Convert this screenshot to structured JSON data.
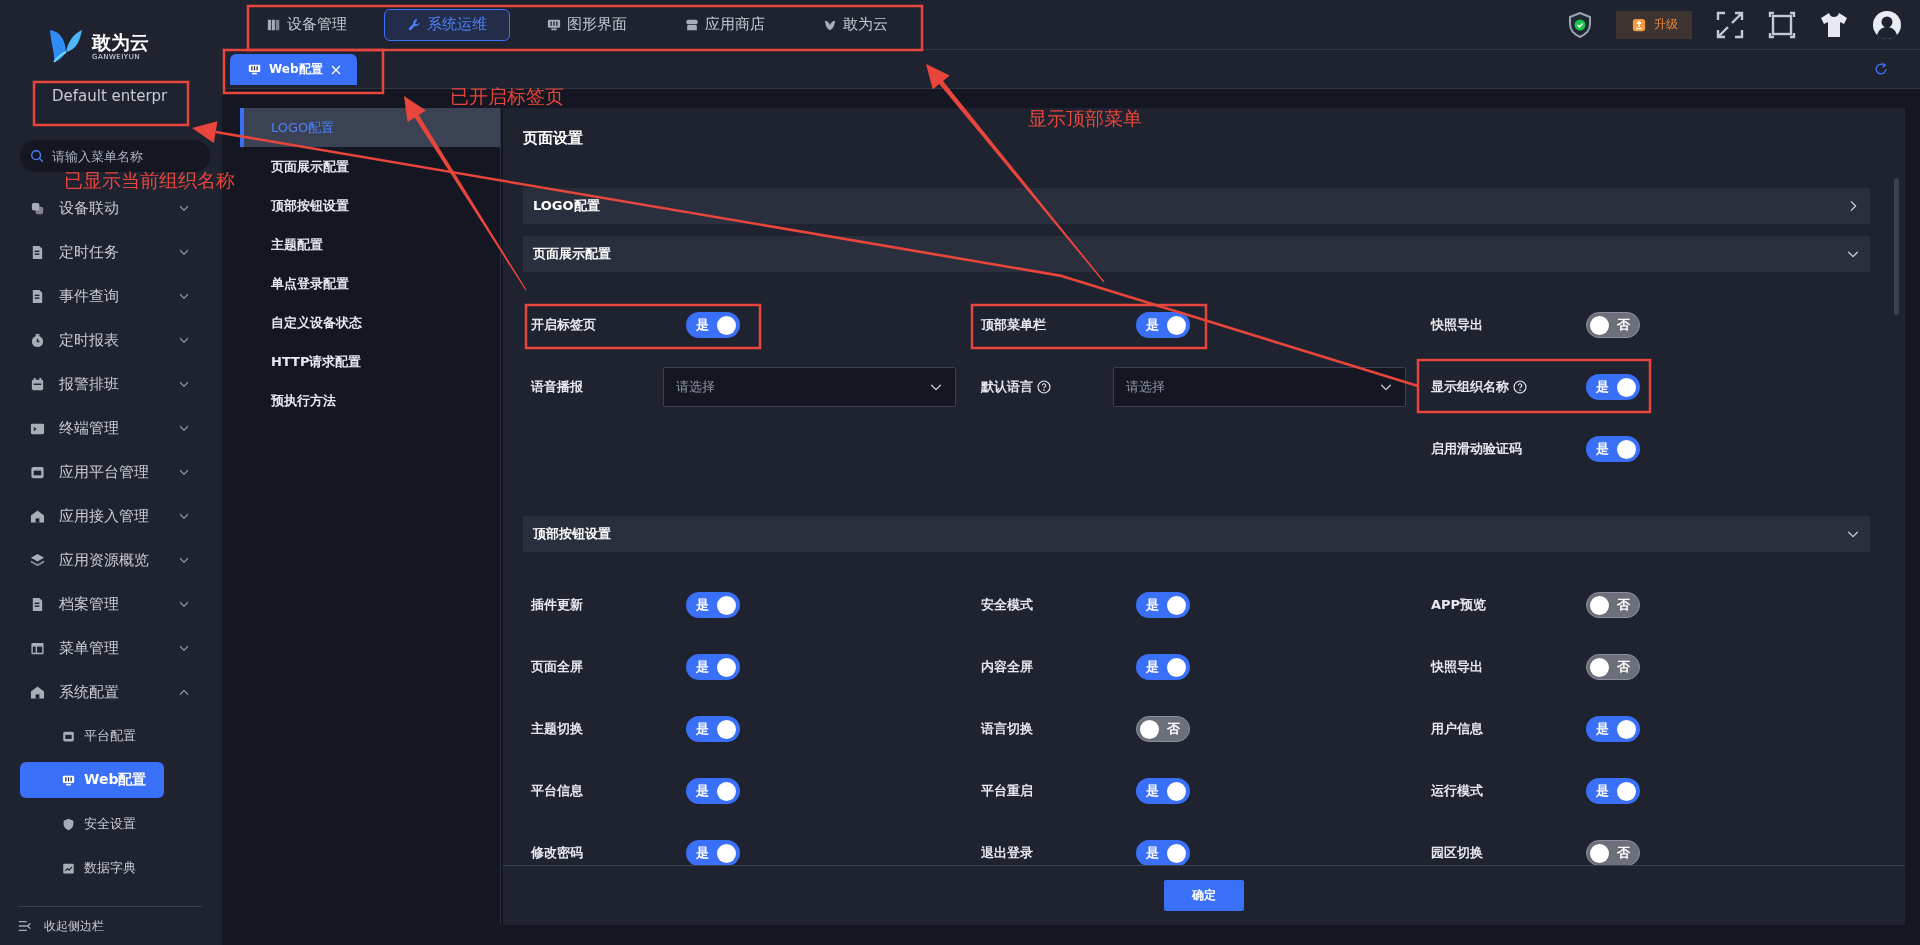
{
  "sidebar": {
    "logo": {
      "name": "敢为云",
      "tagline": "GANWEIYUN"
    },
    "org_name": "Default enterpr",
    "search": {
      "placeholder": "请输入菜单名称"
    },
    "items": [
      {
        "label": "设备联动",
        "expanded": false
      },
      {
        "label": "定时任务",
        "expanded": false
      },
      {
        "label": "事件查询",
        "expanded": false
      },
      {
        "label": "定时报表",
        "expanded": false
      },
      {
        "label": "报警排班",
        "expanded": false
      },
      {
        "label": "终端管理",
        "expanded": false
      },
      {
        "label": "应用平台管理",
        "expanded": false
      },
      {
        "label": "应用接入管理",
        "expanded": false
      },
      {
        "label": "应用资源概览",
        "expanded": false
      },
      {
        "label": "档案管理",
        "expanded": false
      },
      {
        "label": "菜单管理",
        "expanded": false
      },
      {
        "label": "系统配置",
        "expanded": true,
        "children": [
          {
            "label": "平台配置",
            "selected": false
          },
          {
            "label": "Web配置",
            "selected": true
          },
          {
            "label": "安全设置",
            "selected": false
          },
          {
            "label": "数据字典",
            "selected": false
          }
        ]
      }
    ],
    "collapse": "收起侧边栏"
  },
  "top_menu": [
    {
      "label": "设备管理",
      "selected": false
    },
    {
      "label": "系统运维",
      "selected": true
    },
    {
      "label": "图形界面",
      "selected": false
    },
    {
      "label": "应用商店",
      "selected": false
    },
    {
      "label": "敢为云",
      "selected": false
    }
  ],
  "toolbar": {
    "upgrade": "升级"
  },
  "tabs": [
    {
      "label": "Web配置",
      "selected": true
    }
  ],
  "sub_menu": [
    {
      "label": "LOGO配置",
      "selected": true
    },
    {
      "label": "页面展示配置",
      "selected": false
    },
    {
      "label": "顶部按钮设置",
      "selected": false
    },
    {
      "label": "主题配置",
      "selected": false
    },
    {
      "label": "单点登录配置",
      "selected": false
    },
    {
      "label": "自定义设备状态",
      "selected": false
    },
    {
      "label": "HTTP请求配置",
      "selected": false
    },
    {
      "label": "预执行方法",
      "selected": false
    }
  ],
  "panel": {
    "title": "页面设置",
    "sections": [
      {
        "title": "LOGO配置",
        "expanded": false
      },
      {
        "title": "页面展示配置",
        "expanded": true,
        "rows": [
          [
            {
              "kind": "toggle",
              "label": "开启标签页",
              "help": false,
              "on": true,
              "text": "是"
            },
            {
              "kind": "toggle",
              "label": "顶部菜单栏",
              "help": false,
              "on": true,
              "text": "是"
            },
            {
              "kind": "toggle",
              "label": "快照导出",
              "help": false,
              "on": false,
              "text": "否"
            }
          ],
          [
            {
              "kind": "select",
              "label": "语音播报",
              "help": false,
              "placeholder": "请选择"
            },
            {
              "kind": "select",
              "label": "默认语言",
              "help": true,
              "placeholder": "请选择"
            },
            {
              "kind": "toggle",
              "label": "显示组织名称",
              "help": true,
              "on": true,
              "text": "是"
            }
          ],
          [
            null,
            null,
            {
              "kind": "toggle",
              "label": "启用滑动验证码",
              "help": false,
              "on": true,
              "text": "是"
            }
          ]
        ]
      },
      {
        "title": "顶部按钮设置",
        "expanded": true,
        "rows": [
          [
            {
              "kind": "toggle",
              "label": "插件更新",
              "help": false,
              "on": true,
              "text": "是"
            },
            {
              "kind": "toggle",
              "label": "安全模式",
              "help": false,
              "on": true,
              "text": "是"
            },
            {
              "kind": "toggle",
              "label": "APP预览",
              "help": false,
              "on": false,
              "text": "否"
            }
          ],
          [
            {
              "kind": "toggle",
              "label": "页面全屏",
              "help": false,
              "on": true,
              "text": "是"
            },
            {
              "kind": "toggle",
              "label": "内容全屏",
              "help": false,
              "on": true,
              "text": "是"
            },
            {
              "kind": "toggle",
              "label": "快照导出",
              "help": false,
              "on": false,
              "text": "否"
            }
          ],
          [
            {
              "kind": "toggle",
              "label": "主题切换",
              "help": false,
              "on": true,
              "text": "是"
            },
            {
              "kind": "toggle",
              "label": "语言切换",
              "help": false,
              "on": false,
              "text": "否"
            },
            {
              "kind": "toggle",
              "label": "用户信息",
              "help": false,
              "on": true,
              "text": "是"
            }
          ],
          [
            {
              "kind": "toggle",
              "label": "平台信息",
              "help": false,
              "on": true,
              "text": "是"
            },
            {
              "kind": "toggle",
              "label": "平台重启",
              "help": false,
              "on": true,
              "text": "是"
            },
            {
              "kind": "toggle",
              "label": "运行模式",
              "help": false,
              "on": true,
              "text": "是"
            }
          ],
          [
            {
              "kind": "toggle",
              "label": "修改密码",
              "help": false,
              "on": true,
              "text": "是"
            },
            {
              "kind": "toggle",
              "label": "退出登录",
              "help": false,
              "on": true,
              "text": "是"
            },
            {
              "kind": "toggle",
              "label": "园区切换",
              "help": false,
              "on": false,
              "text": "否"
            }
          ]
        ]
      }
    ],
    "confirm": "确定"
  },
  "annotations": [
    {
      "text": "已显示当前组织名称"
    },
    {
      "text": "已开启标签页"
    },
    {
      "text": "显示顶部菜单"
    }
  ]
}
